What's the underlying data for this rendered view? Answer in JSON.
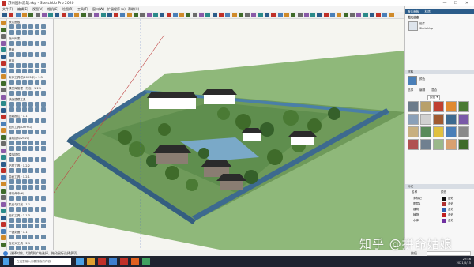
{
  "window": {
    "title": "苏州园林建筑.skp - SketchUp Pro 2020",
    "min_icon": "minimize-icon",
    "max_icon": "maximize-icon",
    "close_icon": "close-icon",
    "min_glyph": "—",
    "max_glyph": "☐",
    "close_glyph": "✕"
  },
  "menu": [
    "文件(F)",
    "编辑(E)",
    "视图(V)",
    "相机(C)",
    "绘图(R)",
    "工具(T)",
    "窗口(W)",
    "扩展程序 (x)",
    "帮助(H)"
  ],
  "left_panel": {
    "sections": [
      {
        "label": "默认面板"
      },
      {
        "label": "指令列表"
      },
      {
        "label": "基础"
      },
      {
        "label": "常用"
      },
      {
        "label": "实体工具栏(2023年) ‑ 1.3"
      },
      {
        "label": "模型库管理 · 打包 · 1.2.1"
      },
      {
        "label": "快速建模工具"
      },
      {
        "label": "超级推拉 · 1.1"
      },
      {
        "label": "图形工具(Ctrl+G)"
      },
      {
        "label": "建筑插件(2020)"
      },
      {
        "label": "模拟插件"
      },
      {
        "label": "贴图工具 · 1.2.2"
      },
      {
        "label": "曲面工具 · 1.2.1"
      },
      {
        "label": "修改命令(6)"
      },
      {
        "label": "表皮与灯光 · 1.1"
      },
      {
        "label": "组件工具 · 3.1.3"
      },
      {
        "label": "一键封面 · 1.1"
      },
      {
        "label": "自定义工具 · 2.1"
      }
    ]
  },
  "right_panel": {
    "default_tray_tab": "默认面板",
    "tray_tab_2": "材质",
    "entity_info": {
      "title": "图元信息",
      "kind": "组件",
      "name": "SketchUp"
    },
    "materials": {
      "title": "材料",
      "current": "颜色",
      "tabs": [
        "选择",
        "编辑",
        "混合"
      ],
      "category": "颜色 ▾"
    },
    "tags": {
      "title": "标记",
      "header_name": "名称",
      "header_color": "颜色",
      "rows": [
        {
          "name": "未标记",
          "dash": "虚线",
          "color": "#111111"
        },
        {
          "name": "图层1",
          "dash": "虚线",
          "color": "#b03030"
        },
        {
          "name": "建筑",
          "dash": "虚线",
          "color": "#3060b0"
        },
        {
          "name": "植物",
          "dash": "虚线",
          "color": "#c02020"
        },
        {
          "name": "水体",
          "dash": "虚线",
          "color": "#7030a0"
        }
      ]
    }
  },
  "status": {
    "text": "选择对象。切换到扩充选择，拖动鼠标选择多项。",
    "measure_label": "数值"
  },
  "taskbar": {
    "start_icon": "windows-start-icon",
    "search_placeholder": "在这里输入你要搜索的内容",
    "time": "22:46",
    "date": "2021/6/15"
  },
  "watermark": "知乎 @拼命姑娘",
  "colors": {
    "sky": "#f5f5f0",
    "ground": "#8fb87a",
    "wall": "#3d6a8f",
    "roof": "#2b2b2b",
    "tree": "#3f6b2a",
    "accent": "#2b5c8a"
  }
}
